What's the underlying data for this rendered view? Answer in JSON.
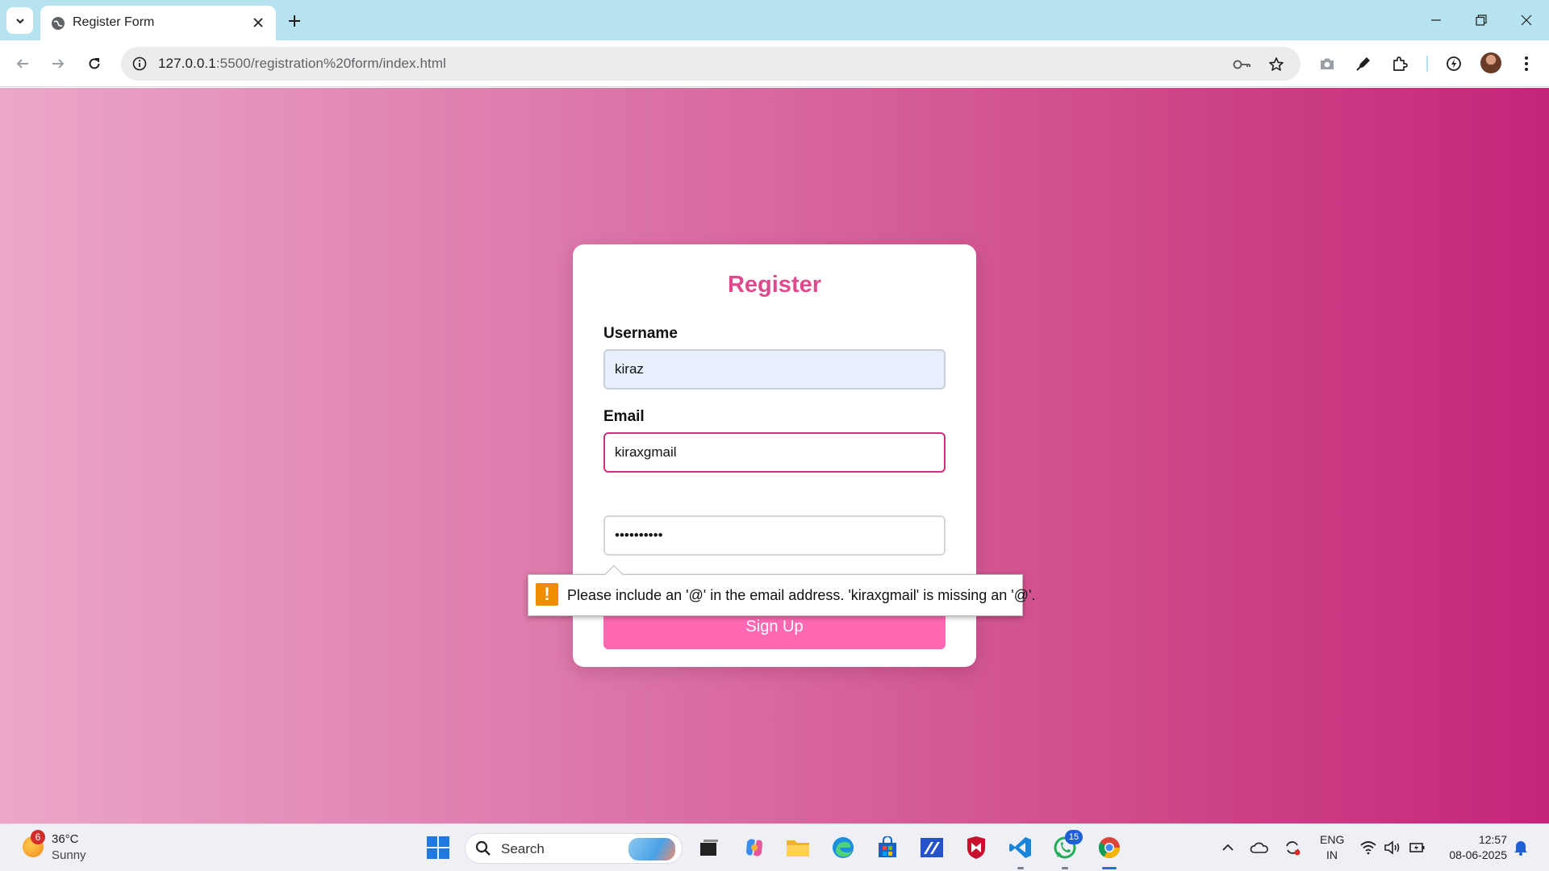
{
  "browser": {
    "tab_title": "Register Form",
    "url_host": "127.0.0.1",
    "url_path": ":5500/registration%20form/index.html"
  },
  "form": {
    "title": "Register",
    "username_label": "Username",
    "username_value": "kiraz",
    "email_label": "Email",
    "email_value": "kiraxgmail",
    "password_value": "••••••••••",
    "submit_label": "Sign Up",
    "validation_message": "Please include an '@' in the email address. 'kiraxgmail' is missing an '@'."
  },
  "taskbar": {
    "weather_temp": "36°C",
    "weather_condition": "Sunny",
    "weather_badge": "6",
    "search_label": "Search",
    "whatsapp_badge": "15",
    "language_line1": "ENG",
    "language_line2": "IN",
    "time": "12:57",
    "date": "08-06-2025"
  },
  "colors": {
    "accent": "#e04a8d",
    "button": "#ff69b4",
    "gradient_start": "#eba7c8",
    "gradient_end": "#c4267a"
  }
}
